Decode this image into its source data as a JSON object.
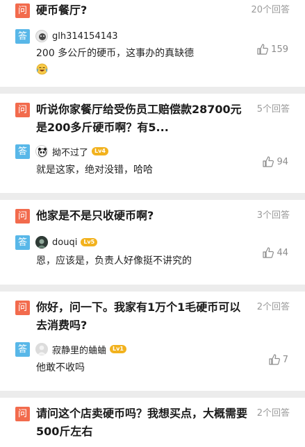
{
  "labels": {
    "question_badge": "问",
    "answer_badge": "答"
  },
  "questions": [
    {
      "title": "硬币餐厅?",
      "answer_count": "20个回答",
      "answer": {
        "username": "glh314154143",
        "text": "200 多公斤的硬币，这事办的真缺德",
        "likes": "159"
      }
    },
    {
      "title": "听说你家餐厅给受伤员工赔偿款28700元是200多斤硬币啊？有5...",
      "answer_count": "5个回答",
      "answer": {
        "username": "拗不过了",
        "level": "Lv4",
        "text": "就是这家，绝对没错，哈哈",
        "likes": "94"
      }
    },
    {
      "title": "他家是不是只收硬币啊?",
      "answer_count": "3个回答",
      "answer": {
        "username": "douqi",
        "level": "Lv5",
        "text": "恩，应该是，负责人好像挺不讲究的",
        "likes": "44"
      }
    },
    {
      "title": "你好，问一下。我家有1万个1毛硬币可以去消费吗?",
      "answer_count": "2个回答",
      "answer": {
        "username": "寂静里的蛐蛐",
        "level": "Lv1",
        "text": "他敢不收吗",
        "likes": "7"
      }
    },
    {
      "title": "请问这个店卖硬币吗？我想买点，大概需要500斤左右",
      "answer_count": "2个回答"
    }
  ],
  "icons": {
    "like": "thumbs-up-icon",
    "avatar": "avatar-icon",
    "emoji": "crying-laughing-emoji-icon"
  },
  "colors": {
    "question_badge": "#f26b4d",
    "answer_badge": "#58b7e8",
    "level_badge": "#f2b21e",
    "background": "#ececec"
  }
}
